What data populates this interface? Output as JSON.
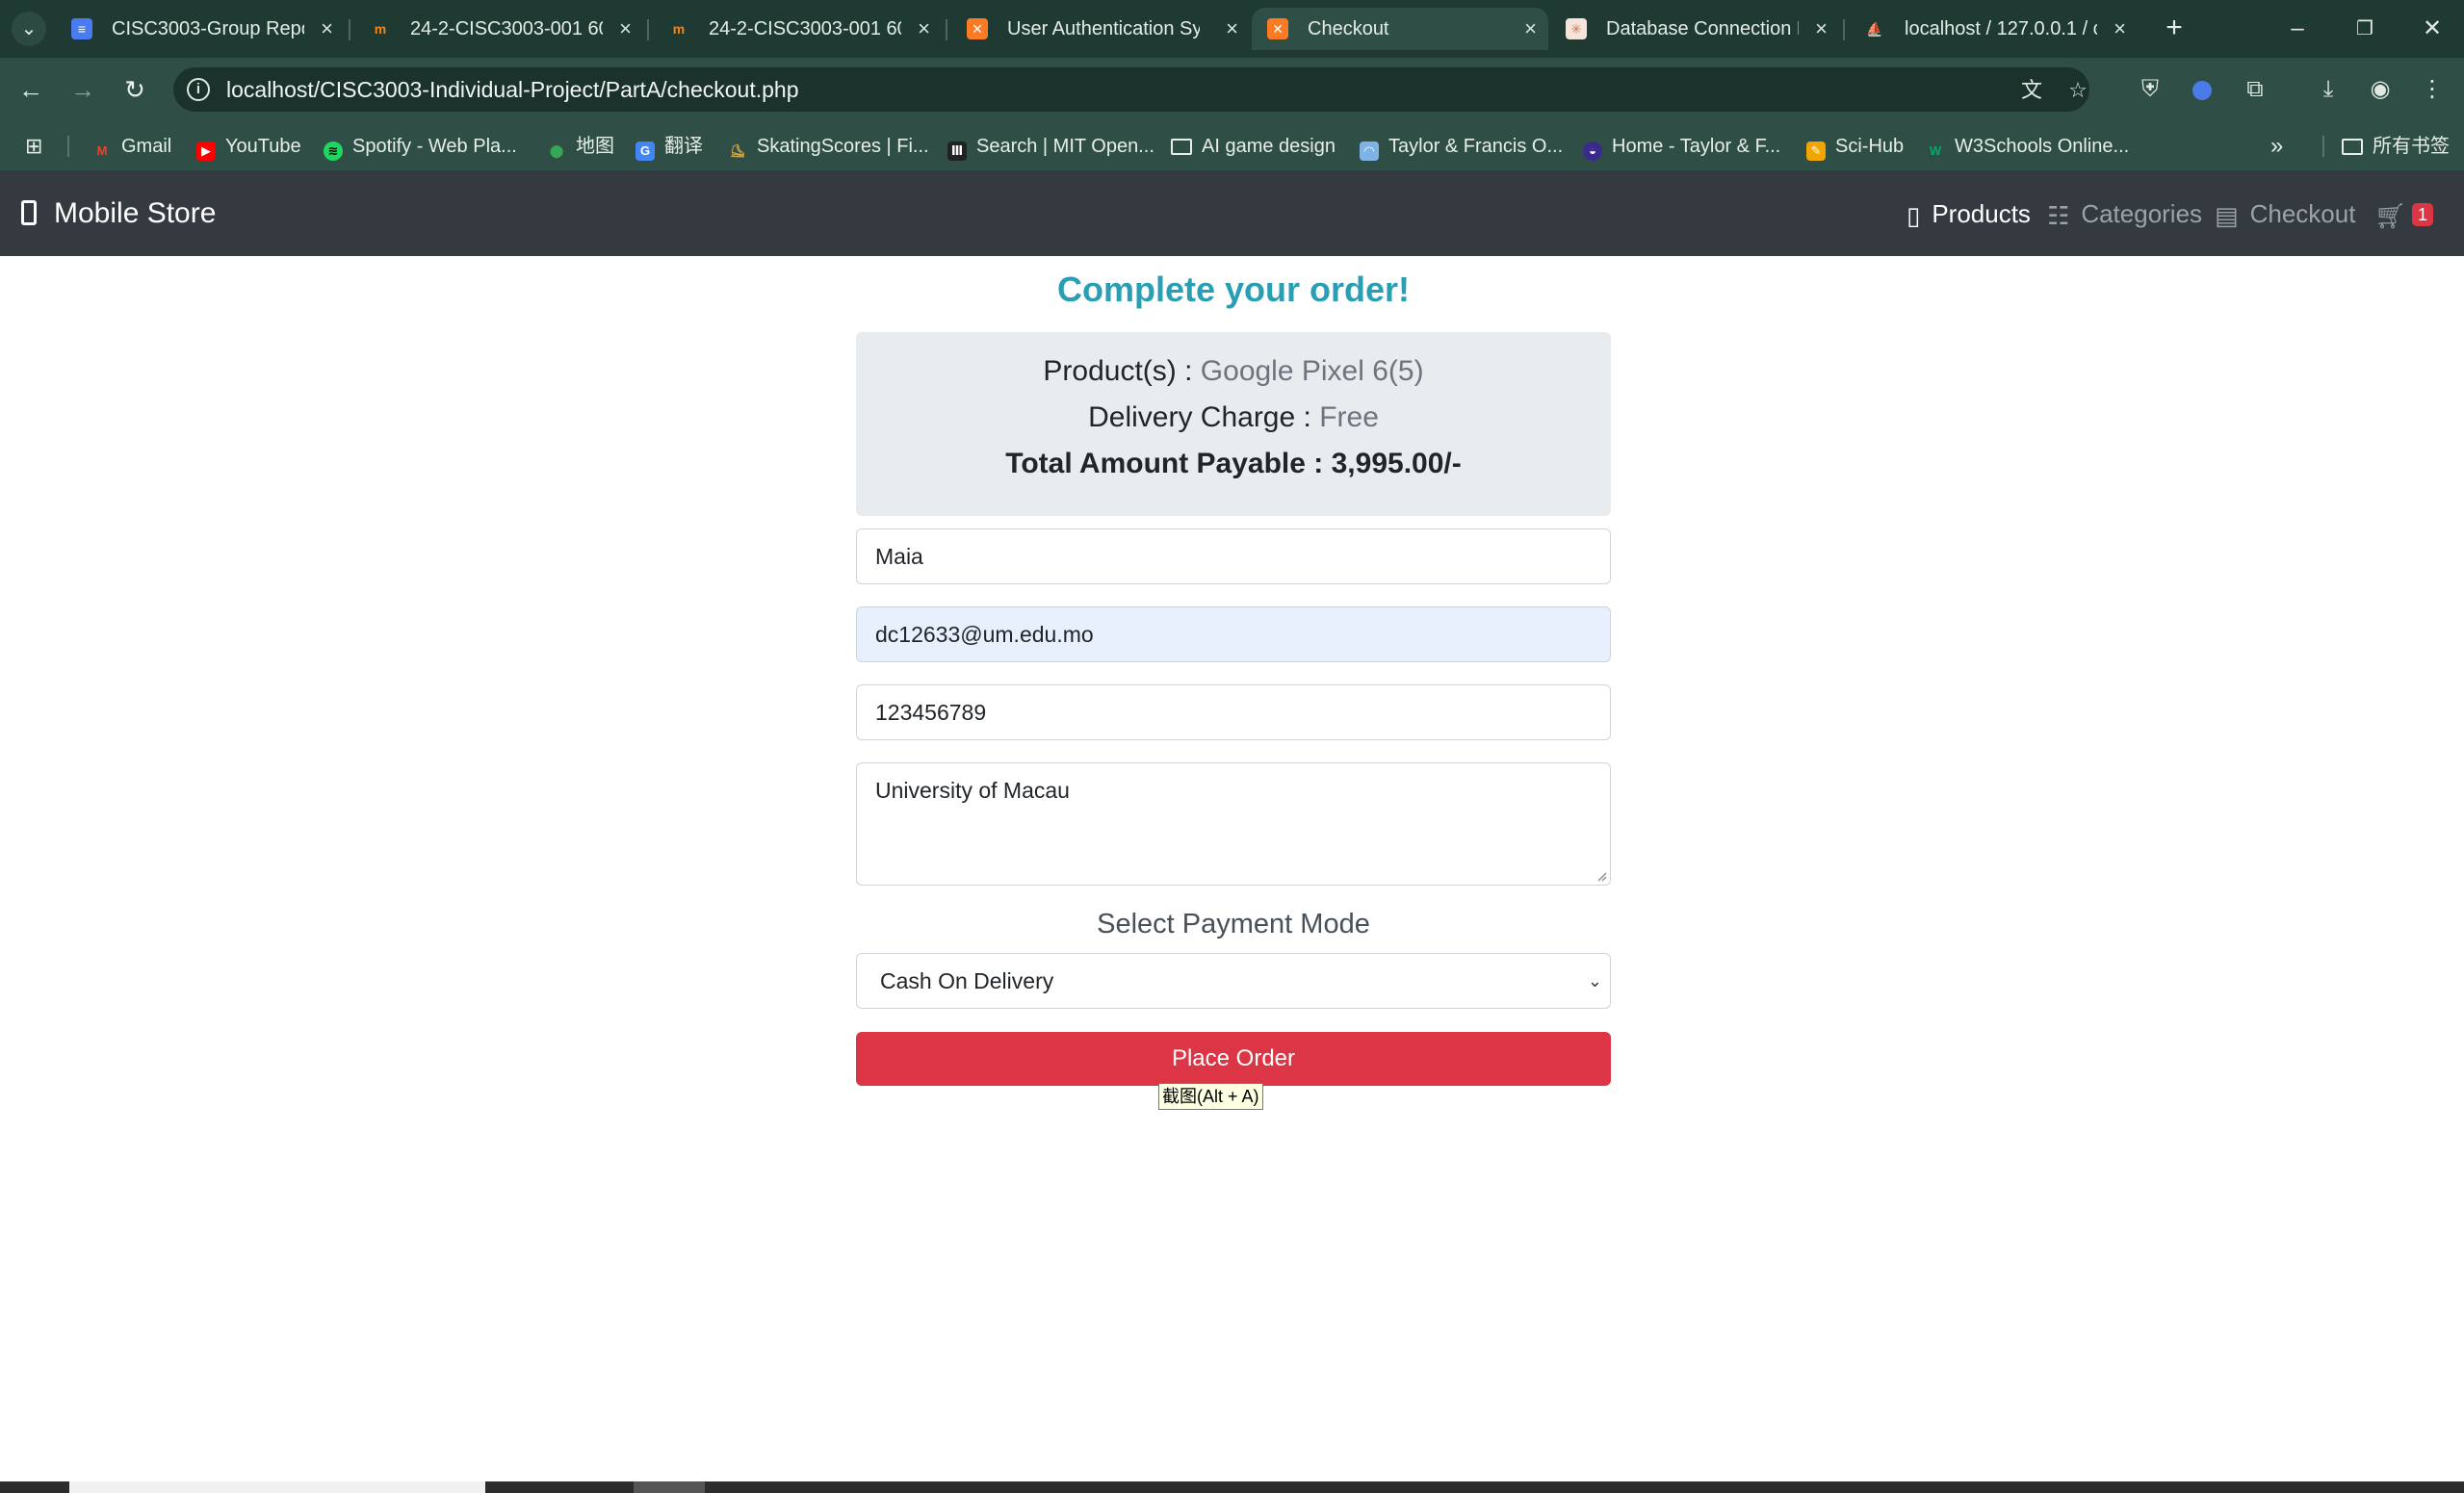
{
  "browser": {
    "tabs": [
      {
        "title": "CISC3003-Group Repor",
        "icon": "docs-icon",
        "color": "#4a7cf0"
      },
      {
        "title": "24-2-CISC3003-001 60",
        "icon": "moodle-icon",
        "color": "#f1861d"
      },
      {
        "title": "24-2-CISC3003-001 60",
        "icon": "moodle-icon",
        "color": "#f1861d"
      },
      {
        "title": "User Authentication Sys",
        "icon": "xampp-icon",
        "color": "#fb7a24"
      },
      {
        "title": "Checkout",
        "icon": "xampp-icon",
        "color": "#fb7a24"
      },
      {
        "title": "Database Connection E",
        "icon": "claude-icon",
        "color": "#d97757"
      },
      {
        "title": "localhost / 127.0.0.1 / c",
        "icon": "phpmyadmin-icon",
        "color": "#f29111"
      }
    ],
    "active_tab_index": 4,
    "url_host": "localhost",
    "url_path": "/CISC3003-Individual-Project/PartA/checkout.php",
    "bookmarks": [
      {
        "label": "Gmail",
        "icon": "gmail-icon",
        "color": "#ea4335"
      },
      {
        "label": "YouTube",
        "icon": "youtube-icon",
        "color": "#ff0000"
      },
      {
        "label": "Spotify - Web Pla...",
        "icon": "spotify-icon",
        "color": "#1ed760"
      },
      {
        "label": "地图",
        "icon": "maps-icon",
        "color": "#34a853"
      },
      {
        "label": "翻译",
        "icon": "translate-icon",
        "color": "#4285f4"
      },
      {
        "label": "SkatingScores | Fi...",
        "icon": "skater-icon",
        "color": "#c9a64b"
      },
      {
        "label": "Search | MIT Open...",
        "icon": "mit-icon",
        "color": "#222222"
      },
      {
        "label": "AI game design",
        "icon": "folder-icon",
        "color": "#2f4f46"
      },
      {
        "label": "Taylor & Francis O...",
        "icon": "tf-icon",
        "color": "#7fb2e5"
      },
      {
        "label": "Home - Taylor & F...",
        "icon": "tf-home-icon",
        "color": "#3a2a8c"
      },
      {
        "label": "Sci-Hub",
        "icon": "scihub-icon",
        "color": "#f0a500"
      },
      {
        "label": "W3Schools Online...",
        "icon": "w3schools-icon",
        "color": "#04aa6d"
      }
    ],
    "other_bookmarks": "所有书签"
  },
  "navbar": {
    "brand": "Mobile Store",
    "links": [
      {
        "label": "Products",
        "icon": "mobile-icon",
        "active": true
      },
      {
        "label": "Categories",
        "icon": "list-icon",
        "active": false
      },
      {
        "label": "Checkout",
        "icon": "card-icon",
        "active": false
      }
    ],
    "cart_count": "1"
  },
  "checkout": {
    "heading": "Complete your order!",
    "products_label": "Product(s) :",
    "products_value": "Google Pixel 6(5)",
    "delivery_label": "Delivery Charge :",
    "delivery_value": "Free",
    "total_label": "Total Amount Payable :",
    "total_value": "3,995.00/-",
    "name_value": "Maia",
    "email_value": "dc12633@um.edu.mo",
    "phone_value": "123456789",
    "address_value": "University of Macau",
    "payment_label": "Select Payment Mode",
    "payment_selected": "Cash On Delivery",
    "submit_label": "Place Order"
  },
  "tooltip": "截图(Alt + A)",
  "colors": {
    "accent": "#2a9fb4",
    "danger": "#dc3545",
    "navbar": "#343a40"
  }
}
